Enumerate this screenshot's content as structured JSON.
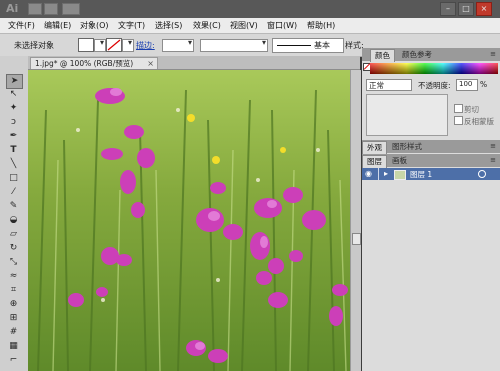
{
  "titlebar": {
    "logo": "Ai",
    "window_buttons": [
      "–",
      "□",
      "×"
    ]
  },
  "menu": {
    "items": [
      "文件(F)",
      "编辑(E)",
      "对象(O)",
      "文字(T)",
      "选择(S)",
      "效果(C)",
      "视图(V)",
      "窗口(W)",
      "帮助(H)"
    ]
  },
  "controlbar": {
    "selection_label": "未选择对象",
    "stroke_label": "描边:",
    "brush_label": "基本",
    "style_label": "样式:"
  },
  "document": {
    "tab_label": "1.jpg* @ 100% (RGB/预览)",
    "close_glyph": "×"
  },
  "panels": {
    "color_tabs": [
      "颜色",
      "颜色参考"
    ],
    "transparency": {
      "mode": "正常",
      "opacity_label": "不透明度:",
      "opacity_value": "100",
      "opacity_unit": "%",
      "clip_label": "剪切",
      "invert_label": "反相蒙版"
    },
    "appearance_tabs": [
      "外观",
      "图形样式"
    ],
    "layer_tabs": [
      "图层",
      "画板"
    ],
    "layer_name": "图层 1"
  },
  "colors": {
    "accent": "#4d6fa8",
    "selected_tab": "#dcdcdc",
    "panel_bg": "#dcdcdc"
  }
}
